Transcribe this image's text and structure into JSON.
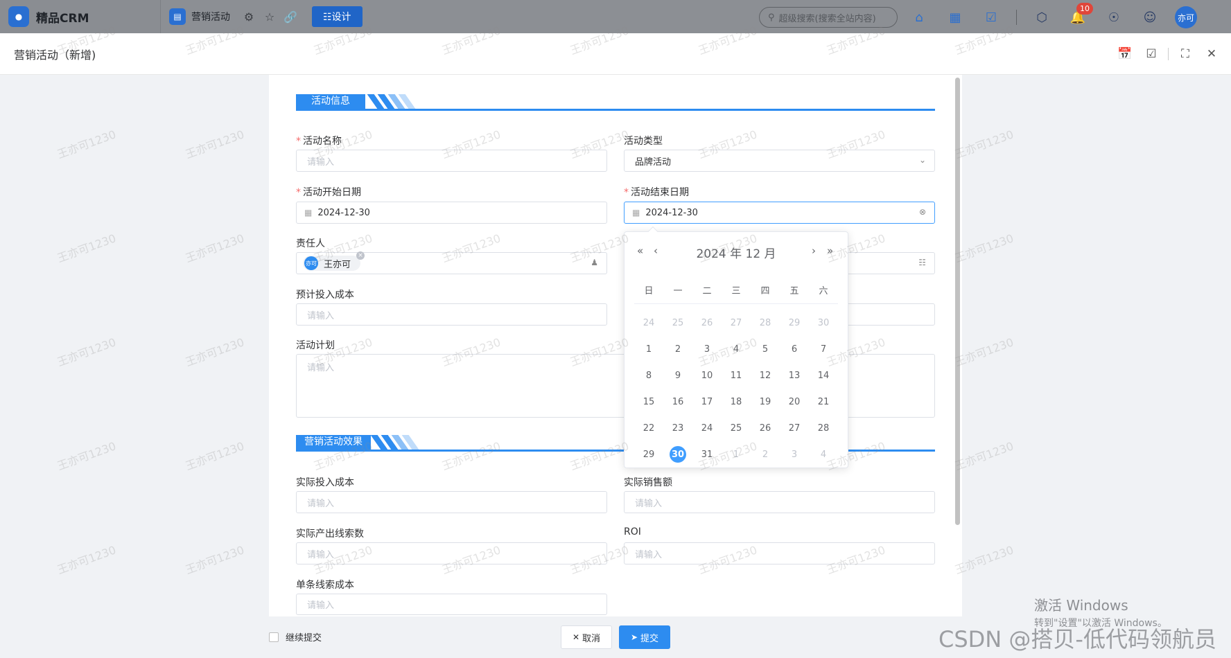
{
  "topbar": {
    "brand_name": "精品CRM",
    "app_name": "营销活动",
    "design_button": "☷设计",
    "search_placeholder": "超级搜索(搜索全站内容)",
    "notification_count": "10",
    "user_avatar": "亦可"
  },
  "header": {
    "title": "营销活动（新增)"
  },
  "sections": {
    "info": "活动信息",
    "effect": "营销活动效果"
  },
  "fields": {
    "activity_name": {
      "label": "活动名称",
      "placeholder": "请输入"
    },
    "activity_type": {
      "label": "活动类型",
      "value": "品牌活动"
    },
    "start_date": {
      "label": "活动开始日期",
      "value": "2024-12-30"
    },
    "end_date": {
      "label": "活动结束日期",
      "value": "2024-12-30"
    },
    "owner": {
      "label": "责任人",
      "avatar": "亦可",
      "name": "王亦可"
    },
    "estimated_cost": {
      "label": "预计投入成本",
      "placeholder": "请输入"
    },
    "plan": {
      "label": "活动计划",
      "placeholder": "请输入"
    },
    "actual_cost": {
      "label": "实际投入成本",
      "placeholder": "请输入"
    },
    "actual_sales": {
      "label": "实际销售额",
      "placeholder": "请输入"
    },
    "actual_leads": {
      "label": "实际产出线索数",
      "placeholder": "请输入"
    },
    "roi": {
      "label": "ROI",
      "placeholder": "请输入"
    },
    "cost_per_lead": {
      "label": "单条线索成本",
      "placeholder": "请输入"
    }
  },
  "date_picker": {
    "title": "2024 年  12 月",
    "weekdays": [
      "日",
      "一",
      "二",
      "三",
      "四",
      "五",
      "六"
    ],
    "days": [
      {
        "d": "24",
        "m": true
      },
      {
        "d": "25",
        "m": true
      },
      {
        "d": "26",
        "m": true
      },
      {
        "d": "27",
        "m": true
      },
      {
        "d": "28",
        "m": true
      },
      {
        "d": "29",
        "m": true
      },
      {
        "d": "30",
        "m": true
      },
      {
        "d": "1"
      },
      {
        "d": "2"
      },
      {
        "d": "3"
      },
      {
        "d": "4"
      },
      {
        "d": "5"
      },
      {
        "d": "6"
      },
      {
        "d": "7"
      },
      {
        "d": "8"
      },
      {
        "d": "9"
      },
      {
        "d": "10"
      },
      {
        "d": "11"
      },
      {
        "d": "12"
      },
      {
        "d": "13"
      },
      {
        "d": "14"
      },
      {
        "d": "15"
      },
      {
        "d": "16"
      },
      {
        "d": "17"
      },
      {
        "d": "18"
      },
      {
        "d": "19"
      },
      {
        "d": "20"
      },
      {
        "d": "21"
      },
      {
        "d": "22"
      },
      {
        "d": "23"
      },
      {
        "d": "24"
      },
      {
        "d": "25"
      },
      {
        "d": "26"
      },
      {
        "d": "27"
      },
      {
        "d": "28"
      },
      {
        "d": "29"
      },
      {
        "d": "30",
        "sel": true
      },
      {
        "d": "31"
      },
      {
        "d": "1",
        "m": true
      },
      {
        "d": "2",
        "m": true
      },
      {
        "d": "3",
        "m": true
      },
      {
        "d": "4",
        "m": true
      }
    ]
  },
  "footer": {
    "continue_label": "继续提交",
    "cancel": "取消",
    "submit": "提交"
  },
  "watermark": "王亦可1230",
  "overlay": {
    "activate_title": "激活 Windows",
    "activate_sub": "转到\"设置\"以激活 Windows。",
    "csdn": "CSDN @搭贝-低代码领航员"
  }
}
